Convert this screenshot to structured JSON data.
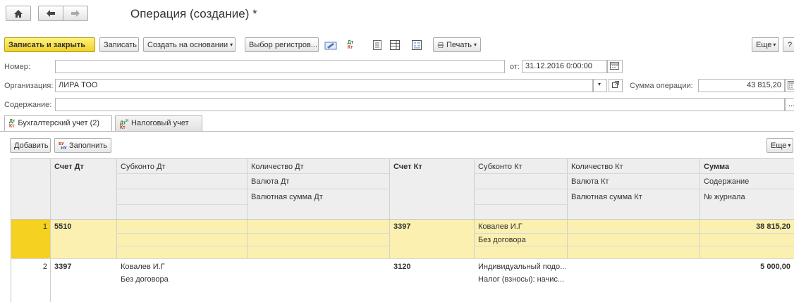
{
  "window": {
    "title": "Операция (создание) *"
  },
  "nav": {
    "home": "home-icon",
    "back": "arrow-left-icon",
    "forward": "arrow-right-icon"
  },
  "toolbar": {
    "save_close": "Записать и закрыть",
    "save": "Записать",
    "create_based": "Создать на основании",
    "select_registers": "Выбор регистров...",
    "print": "Печать",
    "more": "Еще",
    "help": "?"
  },
  "form": {
    "number_label": "Номер:",
    "number_value": "",
    "date_label": "от:",
    "date_value": "31.12.2016 0:00:00",
    "org_label": "Организация:",
    "org_value": "ЛИРА ТОО",
    "sum_label": "Сумма операции:",
    "sum_value": "43 815,20",
    "content_label": "Содержание:",
    "content_value": ""
  },
  "tabs": [
    {
      "label": "Бухгалтерский учет (2)",
      "active": true
    },
    {
      "label": "Налоговый учет",
      "active": false
    }
  ],
  "table_toolbar": {
    "add": "Добавить",
    "fill": "Заполнить",
    "more": "Еще"
  },
  "table": {
    "headers": {
      "acc_dt": "Счет Дт",
      "sub_dt": "Субконто Дт",
      "qty_dt": "Количество Дт",
      "cur_dt": "Валюта Дт",
      "cursum_dt": "Валютная сумма Дт",
      "acc_kt": "Счет Кт",
      "sub_kt": "Субконто Кт",
      "qty_kt": "Количество Кт",
      "cur_kt": "Валюта Кт",
      "cursum_kt": "Валютная сумма Кт",
      "sum": "Сумма",
      "content": "Содержание",
      "journal": "№ журнала"
    },
    "rows": [
      {
        "n": "1",
        "acc_dt": "5510",
        "sub_dt1": "",
        "sub_dt2": "",
        "acc_kt": "3397",
        "sub_kt1": "Ковалев И.Г",
        "sub_kt2": "Без договора",
        "sum": "38 815,20"
      },
      {
        "n": "2",
        "acc_dt": "3397",
        "sub_dt1": "Ковалев И.Г",
        "sub_dt2": "Без договора",
        "acc_kt": "3120",
        "sub_kt1": "Индивидуальный подо...",
        "sub_kt2": "Налог (взносы): начис...",
        "sum": "5 000,00"
      }
    ]
  },
  "colors": {
    "selected_row": "#fbf0b0",
    "row_marker": "#f5d21f",
    "primary_button": "#f1d12a"
  }
}
